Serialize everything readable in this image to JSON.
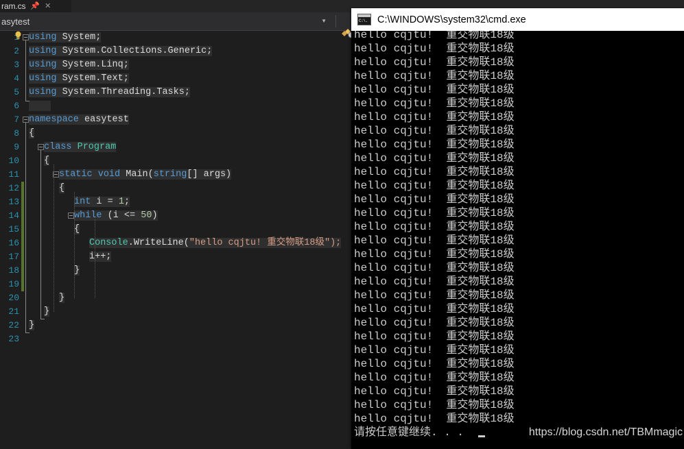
{
  "editor": {
    "tab": {
      "label": "ram.cs",
      "pin_icon": "pin-icon",
      "close_icon": "close-icon"
    },
    "navbar": {
      "scope_value": "asytest",
      "chevron_icon": "chevron-down-icon",
      "member_icon": "method-icon"
    },
    "line_numbers": [
      "1",
      "2",
      "3",
      "4",
      "5",
      "6",
      "7",
      "8",
      "9",
      "10",
      "11",
      "12",
      "13",
      "14",
      "15",
      "16",
      "17",
      "18",
      "19",
      "20",
      "21",
      "22",
      "23"
    ],
    "lightbulb_icon": "lightbulb-icon",
    "code_lines": [
      {
        "n": 1,
        "indent": 0,
        "tokens": [
          {
            "t": "using",
            "c": "kw"
          },
          {
            "t": " System;",
            "c": "pln"
          }
        ]
      },
      {
        "n": 2,
        "indent": 0,
        "tokens": [
          {
            "t": "using",
            "c": "kw"
          },
          {
            "t": " System.Collections.Generic;",
            "c": "pln"
          }
        ]
      },
      {
        "n": 3,
        "indent": 0,
        "tokens": [
          {
            "t": "using",
            "c": "kw"
          },
          {
            "t": " System.Linq;",
            "c": "pln"
          }
        ]
      },
      {
        "n": 4,
        "indent": 0,
        "tokens": [
          {
            "t": "using",
            "c": "kw"
          },
          {
            "t": " System.Text;",
            "c": "pln"
          }
        ]
      },
      {
        "n": 5,
        "indent": 0,
        "tokens": [
          {
            "t": "using",
            "c": "kw"
          },
          {
            "t": " System.Threading.Tasks;",
            "c": "pln"
          }
        ]
      },
      {
        "n": 6,
        "indent": 0,
        "tokens": [
          {
            "t": "    ",
            "c": "pln"
          }
        ]
      },
      {
        "n": 7,
        "indent": 0,
        "tokens": [
          {
            "t": "namespace",
            "c": "kw"
          },
          {
            "t": " easytest",
            "c": "pln"
          }
        ]
      },
      {
        "n": 8,
        "indent": 0,
        "tokens": [
          {
            "t": "{",
            "c": "punc"
          }
        ]
      },
      {
        "n": 9,
        "indent": 1,
        "tokens": [
          {
            "t": "class ",
            "c": "kw"
          },
          {
            "t": "Program",
            "c": "typ"
          }
        ]
      },
      {
        "n": 10,
        "indent": 1,
        "tokens": [
          {
            "t": "{",
            "c": "punc"
          }
        ]
      },
      {
        "n": 11,
        "indent": 2,
        "tokens": [
          {
            "t": "static",
            "c": "kw"
          },
          {
            "t": " ",
            "c": "pln"
          },
          {
            "t": "void",
            "c": "kw"
          },
          {
            "t": " Main(",
            "c": "pln"
          },
          {
            "t": "string",
            "c": "kw"
          },
          {
            "t": "[] args)",
            "c": "pln"
          }
        ]
      },
      {
        "n": 12,
        "indent": 2,
        "tokens": [
          {
            "t": "{",
            "c": "punc"
          }
        ]
      },
      {
        "n": 13,
        "indent": 3,
        "tokens": [
          {
            "t": "int",
            "c": "kw"
          },
          {
            "t": " i = ",
            "c": "pln"
          },
          {
            "t": "1",
            "c": "num"
          },
          {
            "t": ";",
            "c": "pln"
          }
        ]
      },
      {
        "n": 14,
        "indent": 3,
        "tokens": [
          {
            "t": "while",
            "c": "kw"
          },
          {
            "t": " (i <= ",
            "c": "pln"
          },
          {
            "t": "50",
            "c": "num"
          },
          {
            "t": ")",
            "c": "pln"
          }
        ]
      },
      {
        "n": 15,
        "indent": 3,
        "tokens": [
          {
            "t": "{",
            "c": "punc"
          }
        ]
      },
      {
        "n": 16,
        "indent": 4,
        "tokens": [
          {
            "t": "Console",
            "c": "typ"
          },
          {
            "t": ".WriteLine(",
            "c": "pln"
          },
          {
            "t": "\"hello cqjtu! 重交物联18级\");",
            "c": "str"
          }
        ]
      },
      {
        "n": 17,
        "indent": 4,
        "tokens": [
          {
            "t": "i++;",
            "c": "pln"
          }
        ]
      },
      {
        "n": 18,
        "indent": 3,
        "tokens": [
          {
            "t": "}",
            "c": "punc"
          }
        ]
      },
      {
        "n": 19,
        "indent": 3,
        "tokens": [
          {
            "t": "",
            "c": "pln"
          }
        ]
      },
      {
        "n": 20,
        "indent": 2,
        "tokens": [
          {
            "t": "}",
            "c": "punc"
          }
        ]
      },
      {
        "n": 21,
        "indent": 1,
        "tokens": [
          {
            "t": "}",
            "c": "punc"
          }
        ]
      },
      {
        "n": 22,
        "indent": 0,
        "tokens": [
          {
            "t": "}",
            "c": "punc"
          }
        ]
      },
      {
        "n": 23,
        "indent": 0,
        "tokens": [
          {
            "t": "",
            "c": "pln"
          }
        ]
      }
    ],
    "colors": {
      "background": "#1e1e1e",
      "keyword": "#569cd6",
      "type": "#4ec9b0",
      "string": "#d69d85",
      "number": "#b5cea8",
      "line_number": "#2b91af",
      "change_bar_saved": "#57752c"
    }
  },
  "console": {
    "title": "C:\\WINDOWS\\system32\\cmd.exe",
    "app_icon": "cmd-icon",
    "icon_glyph": "C:\\.",
    "output_line": "hello cqjtu!  重交物联18级",
    "output_line_count": 29,
    "prompt_line": "请按任意键继续. . .",
    "cursor": "block-cursor",
    "colors": {
      "background": "#000000",
      "text": "#cccccc",
      "titlebar": "#ffffff"
    }
  },
  "watermark": {
    "text": "https://blog.csdn.net/TBMmagic"
  }
}
